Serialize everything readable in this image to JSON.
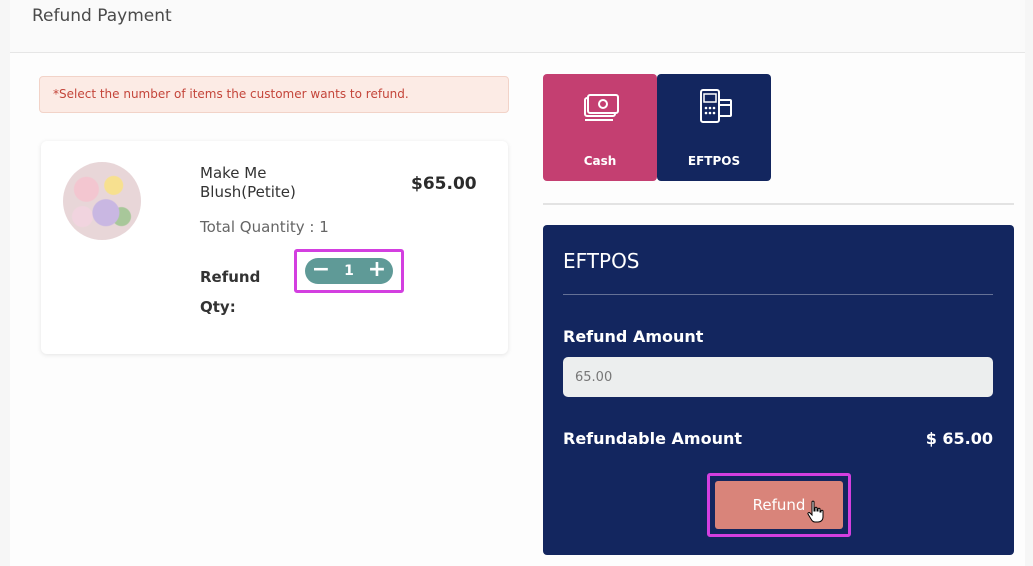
{
  "header": {
    "title": "Refund Payment"
  },
  "notice": {
    "text": "*Select the number of items the customer wants to refund."
  },
  "product": {
    "image_icon": "flower-bouquet-image",
    "name": "Make Me Blush(Petite)",
    "price": "$65.00",
    "total_quantity": "Total Quantity : 1",
    "refund_qty_label": "Refund Qty:",
    "refund_qty_value": "1",
    "minus_symbol": "−",
    "plus_symbol": "+"
  },
  "payment_methods": [
    {
      "label": "Cash",
      "icon": "cash-icon",
      "color": "#c43f71"
    },
    {
      "label": "EFTPOS",
      "icon": "eftpos-terminal-icon",
      "color": "#13265f"
    }
  ],
  "panel": {
    "title": "EFTPOS",
    "refund_amount_label": "Refund Amount",
    "refund_amount_value": "65.00",
    "refundable_label": "Refundable Amount",
    "refundable_value": "$ 65.00",
    "refund_button_label": "Refund"
  },
  "colors": {
    "highlight": "#d33fe0",
    "panel_bg": "#13265f",
    "refund_button": "#d9847a",
    "stepper": "#5f9a97"
  }
}
